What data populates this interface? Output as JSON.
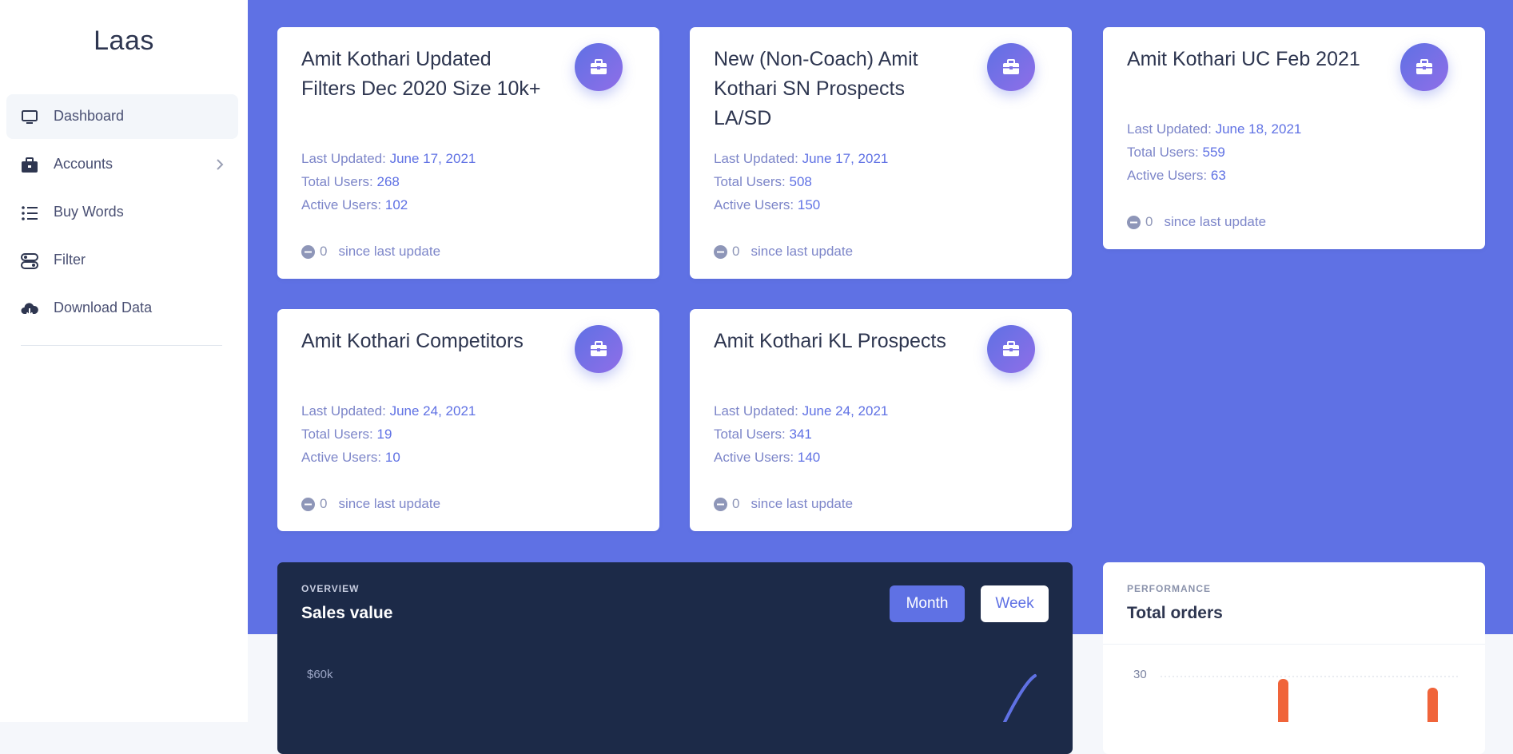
{
  "sidebar": {
    "brand": "Laas",
    "items": [
      {
        "label": "Dashboard"
      },
      {
        "label": "Accounts"
      },
      {
        "label": "Buy Words"
      },
      {
        "label": "Filter"
      },
      {
        "label": "Download Data"
      }
    ]
  },
  "cards": [
    {
      "title": "Amit Kothari Updated Filters Dec 2020 Size 10k+",
      "updated_label": "Last Updated:",
      "updated": "June 17, 2021",
      "total_label": "Total Users:",
      "total": "268",
      "active_label": "Active Users:",
      "active": "102",
      "delta": "0",
      "delta_text": "since last update"
    },
    {
      "title": "New (Non-Coach) Amit Kothari SN Prospects LA/SD",
      "updated_label": "Last Updated:",
      "updated": "June 17, 2021",
      "total_label": "Total Users:",
      "total": "508",
      "active_label": "Active Users:",
      "active": "150",
      "delta": "0",
      "delta_text": "since last update"
    },
    {
      "title": "Amit Kothari UC Feb 2021",
      "updated_label": "Last Updated:",
      "updated": "June 18, 2021",
      "total_label": "Total Users:",
      "total": "559",
      "active_label": "Active Users:",
      "active": "63",
      "delta": "0",
      "delta_text": "since last update"
    },
    {
      "title": "Amit Kothari Competitors",
      "updated_label": "Last Updated:",
      "updated": "June 24, 2021",
      "total_label": "Total Users:",
      "total": "19",
      "active_label": "Active Users:",
      "active": "10",
      "delta": "0",
      "delta_text": "since last update"
    },
    {
      "title": "Amit Kothari KL Prospects",
      "updated_label": "Last Updated:",
      "updated": "June 24, 2021",
      "total_label": "Total Users:",
      "total": "341",
      "active_label": "Active Users:",
      "active": "140",
      "delta": "0",
      "delta_text": "since last update"
    }
  ],
  "sales": {
    "eyebrow": "OVERVIEW",
    "title": "Sales value",
    "month_label": "Month",
    "week_label": "Week",
    "y_tick": "$60k"
  },
  "performance": {
    "eyebrow": "PERFORMANCE",
    "title": "Total orders",
    "y_tick": "30"
  },
  "colors": {
    "primary": "#5f71e4",
    "dark": "#1c2a48",
    "bar": "#f0643a"
  }
}
